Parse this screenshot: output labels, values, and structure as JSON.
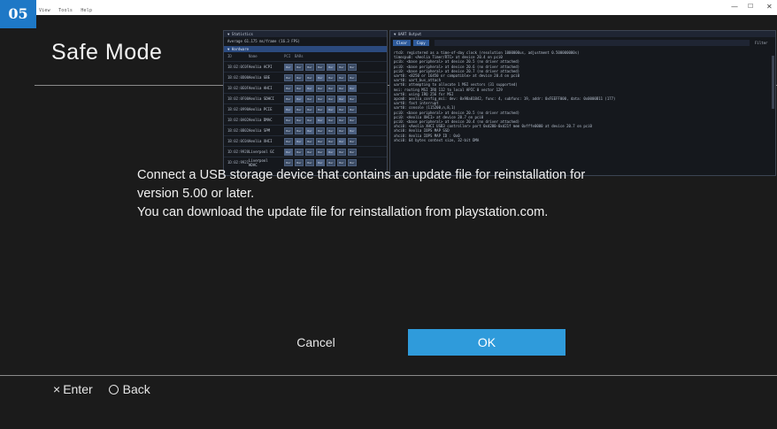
{
  "badge": "05",
  "menubar": [
    "View",
    "Tools",
    "Help"
  ],
  "window_controls": {
    "minimize": "—",
    "maximize": "☐",
    "close": "✕"
  },
  "safe_mode": {
    "title": "Safe Mode",
    "message": [
      "Connect a USB storage device that contains an update file for reinstallation for",
      "version 5.00 or later.",
      "You can download the update file for reinstallation from playstation.com."
    ],
    "cancel_label": "Cancel",
    "ok_label": "OK"
  },
  "footer": {
    "enter_symbol": "×",
    "enter_label": "Enter",
    "back_label": "Back"
  },
  "statistics_panel": {
    "title": "▼ Statistics",
    "average": "Average 61.175 ms/frame (16.3 FPS)",
    "hardware_title": "▼ Hardware",
    "columns": [
      "ID",
      "Name",
      "PCI",
      "BARs"
    ],
    "rows": [
      {
        "id": "1B:02:0C0F",
        "name": "Aeolia ACPI"
      },
      {
        "id": "1B:02:0D00",
        "name": "Aeolia GBE"
      },
      {
        "id": "1B:02:0E0F",
        "name": "Aeolia AHCI"
      },
      {
        "id": "1B:02:0F00",
        "name": "Aeolia SDHCI"
      },
      {
        "id": "1B:02:0990",
        "name": "Aeolia PCIE"
      },
      {
        "id": "1B:02:0A02",
        "name": "Aeolia DMAC"
      },
      {
        "id": "1B:02:0B02",
        "name": "Aeolia SPM"
      },
      {
        "id": "1B:02:0C04",
        "name": "Aeolia XHCI"
      },
      {
        "id": "1D:02:9920",
        "name": "Liverpool GC"
      },
      {
        "id": "1D:02:9921",
        "name": "Liverpool HDAC"
      }
    ],
    "button_label": "Bar"
  },
  "uart_panel": {
    "title": "▼ UART Output",
    "clear_label": "Clear",
    "copy_label": "Copy",
    "filter_label": "Filter",
    "log_lines": [
      "rtc0: registered as a time-of-day clock (resolution 1000000us, adjustment 0.500000000s)",
      "timecpu0: <Aeolia Timer/RTC> at device 20.4 on pci0",
      "pcib: <base peripheral> at device 20.5 (no driver attached)",
      "pci0: <base peripheral> at device 20.6 (no driver attached)",
      "pci0: <base peripheral> at device 20.7 (no driver attached)",
      "uart0: <8250 or 16450 or compatible> at device 20.4 on pci0",
      "uart0: uart_bus_attach",
      "uart0: attempting to allocate 1 MSI vectors (31 supported)",
      "msi: routing MSI IRQ 112 to local APIC 0 vector 129",
      "uart0: using IRQ 256 for MSI",
      "apcm0: aeolia_config_msi: dev: 0x98a81842, func: 4, subfunc: 19, addr: 0xFEEFF000, data: 0x0000B11 (177)",
      "uart0: fast interrupt",
      "uart0: console (115200,n,8,1)",
      "pci0: <base peripheral> at device 20.5 (no driver attached)",
      "pci0: <Aeolia XHCI> at device 20.7 on pci0",
      "pci0: <base peripheral> at device 20.4 (no driver attached)",
      "xhci0: <Aeolia XHCI USB3 controller> port 0xd200-0xd21f mem 0xfffe0000 at device 20.7 on pci0",
      "xhci0: Aeolia IOPS MAP SSD",
      "xhci0: Aeolia IOPS MAP ID : 0x0",
      "xhci0: 64 bytes context size, 32-bit DMA"
    ]
  }
}
